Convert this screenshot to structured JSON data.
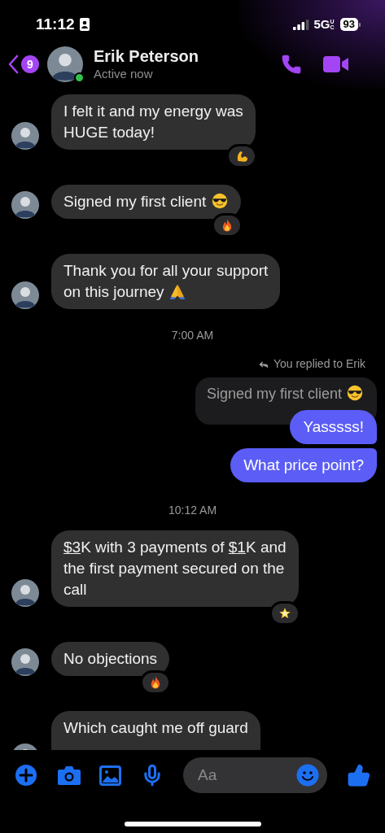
{
  "status_bar": {
    "time": "11:12",
    "network": "5G",
    "network_suffix": "UC",
    "battery": "93"
  },
  "header": {
    "unread_badge": "9",
    "name": "Erik Peterson",
    "status": "Active now",
    "online": true
  },
  "messages": [
    {
      "kind": "incoming",
      "parts": [
        {
          "text": "I felt it and my energy was\nHUGE today!"
        }
      ],
      "reaction": {
        "kind": "flexed-arm"
      }
    },
    {
      "kind": "incoming",
      "parts": [
        {
          "text": "Signed my first client"
        }
      ],
      "emoji": {
        "kind": "sunglasses"
      },
      "reaction": {
        "kind": "fire"
      }
    },
    {
      "kind": "incoming",
      "parts": [
        {
          "text": "Thank you for all your support\non this journey"
        }
      ],
      "emoji": {
        "kind": "praying-hands"
      }
    },
    {
      "kind": "timestamp",
      "text": "7:00 AM"
    },
    {
      "kind": "reply_note",
      "text": "You replied to Erik"
    },
    {
      "kind": "quoted",
      "parts": [
        {
          "text": "Signed my first client"
        }
      ],
      "emoji": {
        "kind": "sunglasses"
      }
    },
    {
      "kind": "outgoing",
      "parts": [
        {
          "text": "Yasssss!"
        }
      ]
    },
    {
      "kind": "outgoing",
      "parts": [
        {
          "text": "What price point?"
        }
      ]
    },
    {
      "kind": "timestamp",
      "text": "10:12 AM"
    },
    {
      "kind": "incoming",
      "parts": [
        {
          "text": "$3",
          "link": true
        },
        {
          "text": "K with 3 payments of "
        },
        {
          "text": "$1",
          "link": true
        },
        {
          "text": "K and\nthe first payment secured on the\ncall"
        }
      ],
      "reaction": {
        "kind": "star"
      }
    },
    {
      "kind": "incoming",
      "parts": [
        {
          "text": "No objections"
        }
      ],
      "reaction": {
        "kind": "fire"
      }
    },
    {
      "kind": "incoming",
      "parts": [
        {
          "text": "Which caught me off guard"
        }
      ]
    }
  ],
  "composer": {
    "placeholder": "Aa"
  }
}
